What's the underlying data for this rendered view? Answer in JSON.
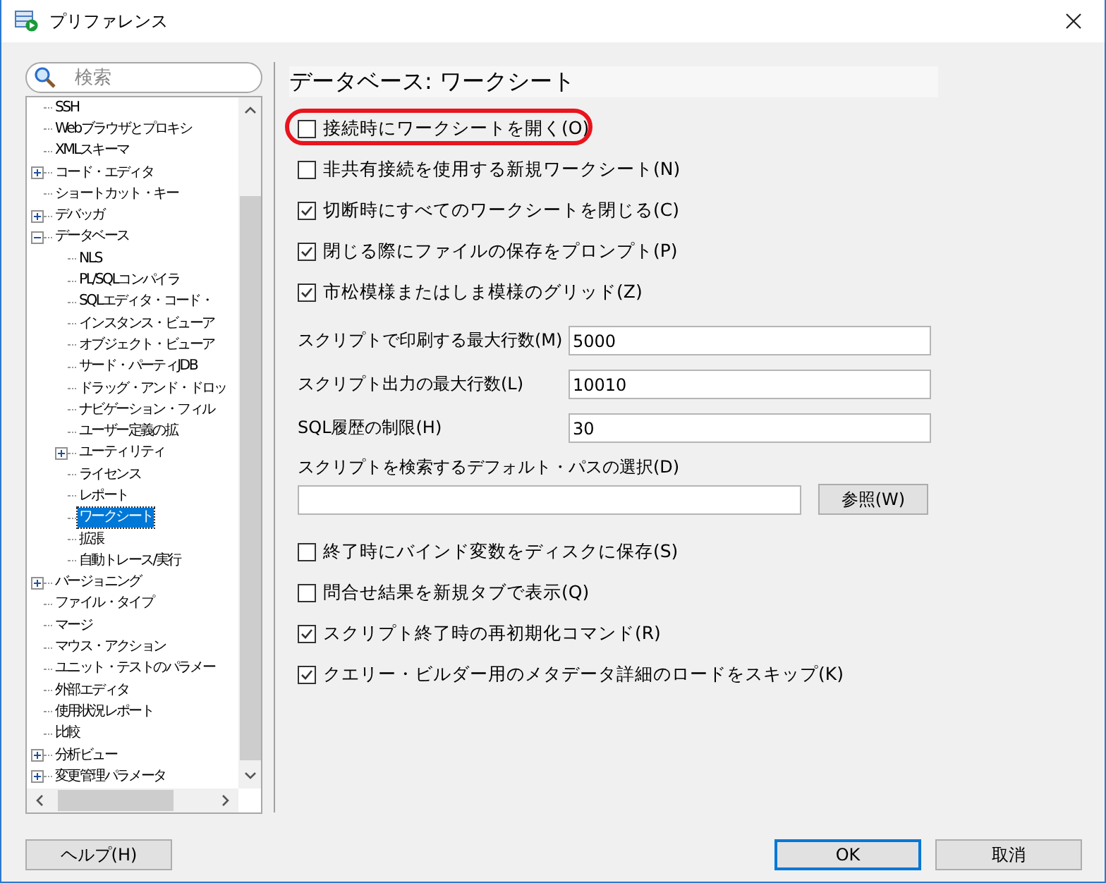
{
  "window": {
    "title": "プリファレンス"
  },
  "search": {
    "placeholder": "検索"
  },
  "tree": [
    {
      "label": "SSH",
      "selected": false
    },
    {
      "label": "Webブラウザとプロキシ",
      "selected": false
    },
    {
      "label": "XMLスキーマ",
      "selected": false
    },
    {
      "label": "コード・エディタ",
      "selected": false,
      "expanded": false
    },
    {
      "label": "ショートカット・キー",
      "selected": false
    },
    {
      "label": "デバッガ",
      "selected": false,
      "expanded": false
    },
    {
      "label": "データベース",
      "selected": false,
      "expanded": true,
      "children": [
        {
          "label": "NLS",
          "selected": false
        },
        {
          "label": "PL/SQLコンパイラ",
          "selected": false
        },
        {
          "label": "SQLエディタ・コード・",
          "selected": false
        },
        {
          "label": "インスタンス・ビューア",
          "selected": false
        },
        {
          "label": "オブジェクト・ビューア",
          "selected": false
        },
        {
          "label": "サード・パーティJDB",
          "selected": false
        },
        {
          "label": "ドラッグ・アンド・ドロッ",
          "selected": false
        },
        {
          "label": "ナビゲーション・フィル",
          "selected": false
        },
        {
          "label": "ユーザー定義の拡",
          "selected": false
        },
        {
          "label": "ユーティリティ",
          "selected": false,
          "expanded": false
        },
        {
          "label": "ライセンス",
          "selected": false
        },
        {
          "label": "レポート",
          "selected": false
        },
        {
          "label": "ワークシート",
          "selected": true
        },
        {
          "label": "拡張",
          "selected": false
        },
        {
          "label": "自動トレース/実行",
          "selected": false
        }
      ]
    },
    {
      "label": "バージョニング",
      "selected": false,
      "expanded": false
    },
    {
      "label": "ファイル・タイプ",
      "selected": false
    },
    {
      "label": "マージ",
      "selected": false
    },
    {
      "label": "マウス・アクション",
      "selected": false
    },
    {
      "label": "ユニット・テストのパラメー",
      "selected": false
    },
    {
      "label": "外部エディタ",
      "selected": false
    },
    {
      "label": "使用状況レポート",
      "selected": false
    },
    {
      "label": "比較",
      "selected": false
    },
    {
      "label": "分析ビュー",
      "selected": false,
      "expanded": false
    },
    {
      "label": "変更管理パラメータ",
      "selected": false,
      "expanded": false
    }
  ],
  "heading": "データベース: ワークシート",
  "options_top": [
    {
      "label": "接続時にワークシートを開く(O)",
      "checked": false,
      "highlighted": true
    },
    {
      "label": "非共有接続を使用する新規ワークシート(N)",
      "checked": false,
      "highlighted": false
    },
    {
      "label": "切断時にすべてのワークシートを閉じる(C)",
      "checked": true,
      "highlighted": false
    },
    {
      "label": "閉じる際にファイルの保存をプロンプト(P)",
      "checked": true,
      "highlighted": false
    },
    {
      "label": "市松模様またはしま模様のグリッド(Z)",
      "checked": true,
      "highlighted": false
    }
  ],
  "fields": [
    {
      "label": "スクリプトで印刷する最大行数(M)",
      "value": "5000"
    },
    {
      "label": "スクリプト出力の最大行数(L)",
      "value": "10010"
    },
    {
      "label": "SQL履歴の制限(H)",
      "value": "30"
    }
  ],
  "path": {
    "label": "スクリプトを検索するデフォルト・パスの選択(D)",
    "browse": "参照(W)"
  },
  "options_bottom": [
    {
      "label": "終了時にバインド変数をディスクに保存(S)",
      "checked": false
    },
    {
      "label": "問合せ結果を新規タブで表示(Q)",
      "checked": false
    },
    {
      "label": "スクリプト終了時の再初期化コマンド(R)",
      "checked": true
    },
    {
      "label": "クエリー・ビルダー用のメタデータ詳細のロードをスキップ(K)",
      "checked": true
    }
  ],
  "buttons": {
    "help": "ヘルプ(H)",
    "ok": "OK",
    "cancel": "取消"
  }
}
